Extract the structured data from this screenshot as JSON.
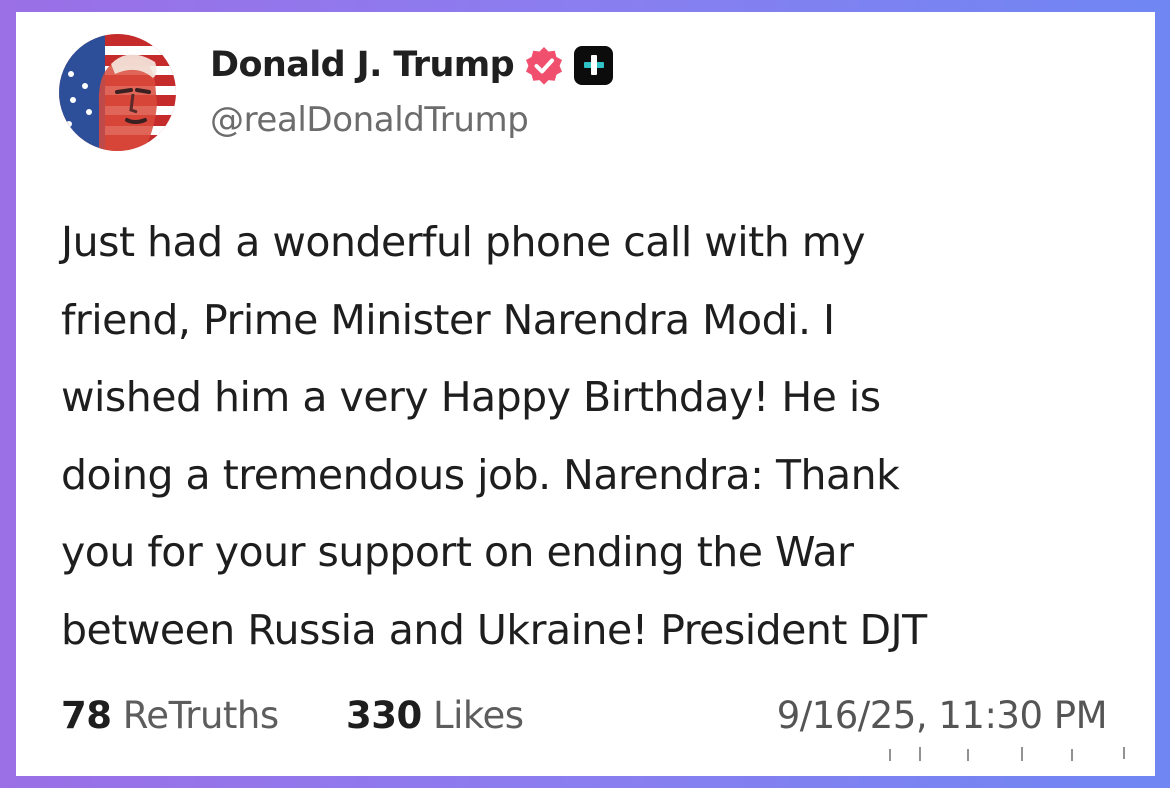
{
  "profile": {
    "display_name": "Donald J. Trump",
    "handle": "@realDonaldTrump",
    "avatar_icon": "portrait-flag-icon",
    "verified_icon": "verified-badge-icon",
    "verified_color": "#f0506e",
    "plus_icon": "plus-badge-icon"
  },
  "post": {
    "lines": [
      "Just had a wonderful phone call with my",
      "friend, Prime Minister Narendra Modi. I",
      "wished him a very Happy Birthday! He is",
      "doing a tremendous job. Narendra: Thank",
      "you for your support on ending the War",
      "between Russia and Ukraine! President DJT"
    ]
  },
  "stats": {
    "retruths_count": "78",
    "retruths_label": "ReTruths",
    "likes_count": "330",
    "likes_label": "Likes",
    "timestamp": "9/16/25, 11:30 PM"
  },
  "colors": {
    "frame_left": "#9b6fe6",
    "frame_right": "#6f86f3",
    "card": "#ffffff",
    "text": "#1e1e1e",
    "muted": "#6c6c6c"
  }
}
